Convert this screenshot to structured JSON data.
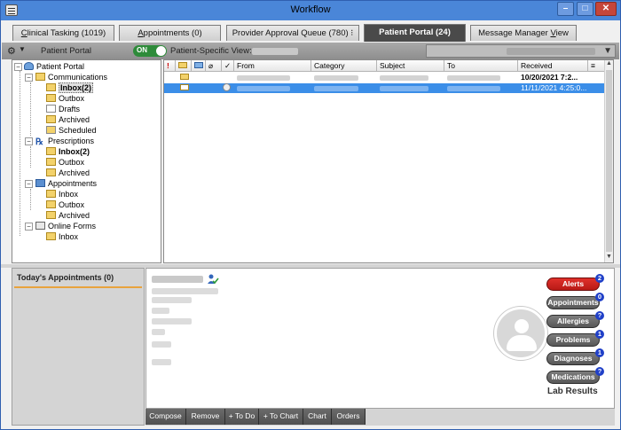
{
  "window": {
    "title": "Workflow"
  },
  "tabs": [
    {
      "label": "Clinical Tasking (1019)",
      "underline_char": "C",
      "rest": "linical Tasking (1019)"
    },
    {
      "label": "Appointments (0)",
      "underline_char": "A",
      "rest": "ppointments (0)"
    },
    {
      "label": "Provider Approval Queue (780) ⁝"
    },
    {
      "label": "Patient Portal (24)"
    },
    {
      "label": "Message Manager View",
      "prefix": "Message Manager ",
      "underline_char": "V",
      "rest": "iew"
    }
  ],
  "toolbar": {
    "section_label": "Patient Portal",
    "toggle_label": "ON",
    "view_label": "Patient-Specific View:"
  },
  "tree": {
    "patient_portal": "Patient Portal",
    "communications": "Communications",
    "comm_inbox": "Inbox(2)",
    "comm_outbox": "Outbox",
    "comm_drafts": "Drafts",
    "comm_archived": "Archived",
    "comm_scheduled": "Scheduled",
    "prescriptions": "Prescriptions",
    "rx_inbox": "Inbox(2)",
    "rx_outbox": "Outbox",
    "rx_archived": "Archived",
    "appointments": "Appointments",
    "ap_inbox": "Inbox",
    "ap_outbox": "Outbox",
    "ap_archived": "Archived",
    "online_forms": "Online Forms",
    "of_inbox": "Inbox",
    "expand_minus": "−"
  },
  "grid": {
    "columns": {
      "flag": "!",
      "from": "From",
      "category": "Category",
      "subject": "Subject",
      "to": "To",
      "received": "Received"
    },
    "rows": [
      {
        "received": "10/20/2021 7:2..."
      },
      {
        "received": "11/11/2021 4:25:0..."
      }
    ]
  },
  "appointments_panel": {
    "title": "Today's Appointments (0)"
  },
  "details": {
    "pills": [
      {
        "label": "Alerts",
        "badge": "2",
        "color": "#d8251f"
      },
      {
        "label": "Appointments",
        "badge": "0"
      },
      {
        "label": "Allergies",
        "badge": "?"
      },
      {
        "label": "Problems",
        "badge": "1"
      },
      {
        "label": "Diagnoses",
        "badge": "1"
      },
      {
        "label": "Medications",
        "badge": "?"
      }
    ],
    "lab_results": "Lab Results"
  },
  "actions": [
    "Compose",
    "Remove",
    "+ To Do",
    "+ To Chart",
    "Chart",
    "Orders"
  ],
  "icons": {
    "gear": "⚙",
    "caret": "▼",
    "scroll_up": "▲",
    "scroll_down": "▼",
    "min": "–",
    "max": "□",
    "close": "✕",
    "rx": "℞",
    "check": "✓"
  },
  "colors": {
    "title_bar": "#4a86d8",
    "selected_row": "#3b8ee8",
    "toggle_on": "#2e8b3a",
    "alert_red": "#d8251f",
    "badge_blue": "#2040c8"
  }
}
